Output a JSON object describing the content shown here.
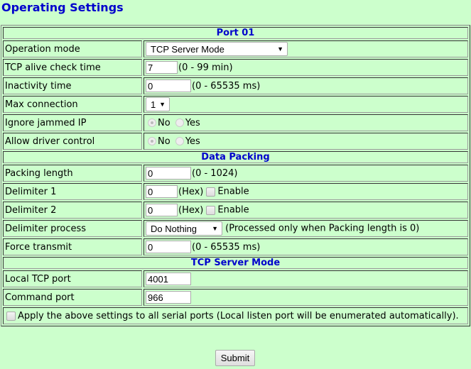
{
  "page": {
    "title": "Operating Settings"
  },
  "port_section": {
    "header": "Port 01",
    "operation_mode": {
      "label": "Operation mode",
      "value": "TCP Server Mode"
    },
    "tcp_alive": {
      "label": "TCP alive check time",
      "value": "7",
      "hint": "(0 - 99 min)"
    },
    "inactivity": {
      "label": "Inactivity time",
      "value": "0",
      "hint": "(0 - 65535 ms)"
    },
    "max_connection": {
      "label": "Max connection",
      "value": "1"
    },
    "ignore_jammed": {
      "label": "Ignore jammed IP",
      "options": [
        "No",
        "Yes"
      ],
      "selected": "No"
    },
    "allow_driver": {
      "label": "Allow driver control",
      "options": [
        "No",
        "Yes"
      ],
      "selected": "No"
    }
  },
  "data_packing": {
    "header": "Data Packing",
    "packing_length": {
      "label": "Packing length",
      "value": "0",
      "hint": "(0 - 1024)"
    },
    "delimiter1": {
      "label": "Delimiter 1",
      "value": "0",
      "hint": "(Hex)",
      "enable_label": "Enable",
      "enabled": false
    },
    "delimiter2": {
      "label": "Delimiter 2",
      "value": "0",
      "hint": "(Hex)",
      "enable_label": "Enable",
      "enabled": false
    },
    "delimiter_process": {
      "label": "Delimiter process",
      "value": "Do Nothing",
      "hint": "(Processed only when Packing length is 0)"
    },
    "force_transmit": {
      "label": "Force transmit",
      "value": "0",
      "hint": "(0 - 65535 ms)"
    }
  },
  "tcp_server": {
    "header": "TCP Server Mode",
    "local_port": {
      "label": "Local TCP port",
      "value": "4001"
    },
    "command_port": {
      "label": "Command port",
      "value": "966"
    }
  },
  "apply_all": {
    "label": "Apply the above settings to all serial ports (Local listen port will be enumerated automatically).",
    "checked": false
  },
  "submit_label": "Submit"
}
